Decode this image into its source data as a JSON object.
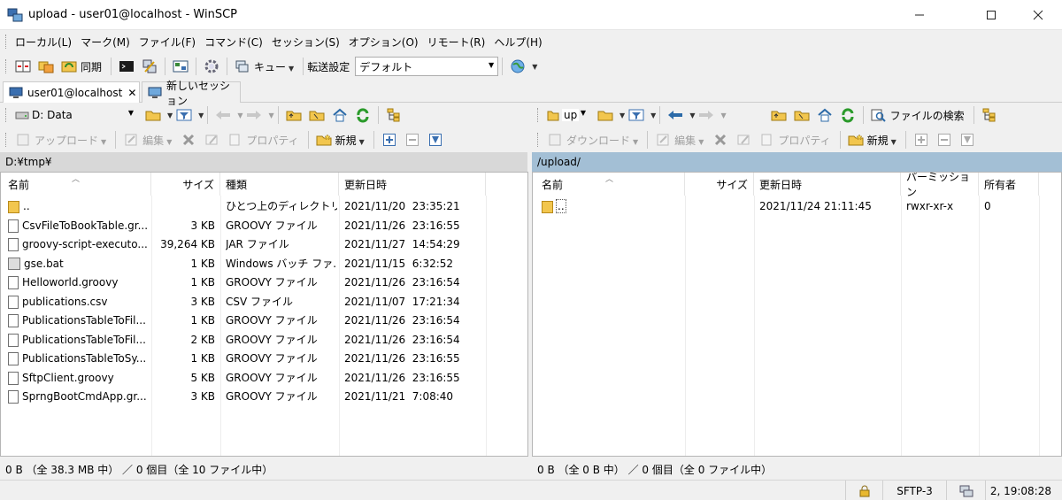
{
  "window": {
    "title": "upload - user01@localhost - WinSCP"
  },
  "menu": [
    "ローカル(L)",
    "マーク(M)",
    "ファイル(F)",
    "コマンド(C)",
    "セッション(S)",
    "オプション(O)",
    "リモート(R)",
    "ヘルプ(H)"
  ],
  "toolbar": {
    "sync_label": "同期",
    "queue_label": "キュー",
    "transfer_settings_label": "転送設定",
    "transfer_preset": "デフォルト"
  },
  "tabs": {
    "session": "user01@localhost",
    "new_session": "新しいセッション"
  },
  "left_panel": {
    "drive": "D: Data",
    "upload_label": "アップロード",
    "edit_label": "編集",
    "properties_label": "プロパティ",
    "new_label": "新規",
    "path": "D:¥tmp¥",
    "columns": {
      "name": "名前",
      "size": "サイズ",
      "type": "種類",
      "modified": "更新日時"
    },
    "files": [
      {
        "name": "..",
        "size": "",
        "type": "ひとつ上のディレクトリ",
        "modified": "2021/11/20  23:35:21",
        "icon": "parent-dir"
      },
      {
        "name": "CsvFileToBookTable.gr...",
        "size": "3 KB",
        "type": "GROOVY ファイル",
        "modified": "2021/11/26  23:16:55",
        "icon": "file"
      },
      {
        "name": "groovy-script-executo...",
        "size": "39,264 KB",
        "type": "JAR ファイル",
        "modified": "2021/11/27  14:54:29",
        "icon": "file"
      },
      {
        "name": "gse.bat",
        "size": "1 KB",
        "type": "Windows バッチ ファ...",
        "modified": "2021/11/15  6:32:52",
        "icon": "bat"
      },
      {
        "name": "Helloworld.groovy",
        "size": "1 KB",
        "type": "GROOVY ファイル",
        "modified": "2021/11/26  23:16:54",
        "icon": "file"
      },
      {
        "name": "publications.csv",
        "size": "3 KB",
        "type": "CSV ファイル",
        "modified": "2021/11/07  17:21:34",
        "icon": "file"
      },
      {
        "name": "PublicationsTableToFil...",
        "size": "1 KB",
        "type": "GROOVY ファイル",
        "modified": "2021/11/26  23:16:54",
        "icon": "file"
      },
      {
        "name": "PublicationsTableToFil...",
        "size": "2 KB",
        "type": "GROOVY ファイル",
        "modified": "2021/11/26  23:16:54",
        "icon": "file"
      },
      {
        "name": "PublicationsTableToSy...",
        "size": "1 KB",
        "type": "GROOVY ファイル",
        "modified": "2021/11/26  23:16:55",
        "icon": "file"
      },
      {
        "name": "SftpClient.groovy",
        "size": "5 KB",
        "type": "GROOVY ファイル",
        "modified": "2021/11/26  23:16:55",
        "icon": "file"
      },
      {
        "name": "SprngBootCmdApp.gr...",
        "size": "3 KB",
        "type": "GROOVY ファイル",
        "modified": "2021/11/21  7:08:40",
        "icon": "file"
      }
    ],
    "status": "0 B （全 38.3 MB 中） ／ 0 個目（全 10 ファイル中）"
  },
  "right_panel": {
    "folder": "up",
    "search_label": "ファイルの検索",
    "download_label": "ダウンロード",
    "edit_label": "編集",
    "properties_label": "プロパティ",
    "new_label": "新規",
    "path": "/upload/",
    "columns": {
      "name": "名前",
      "size": "サイズ",
      "modified": "更新日時",
      "permissions": "パーミッション",
      "owner": "所有者"
    },
    "files": [
      {
        "name": "..",
        "size": "",
        "modified": "2021/11/24 21:11:45",
        "permissions": "rwxr-xr-x",
        "owner": "0"
      }
    ],
    "status": "0 B （全 0 B 中） ／ 0 個目（全 0 ファイル中）"
  },
  "statusbar": {
    "protocol": "SFTP-3",
    "time": "2, 19:08:28"
  }
}
